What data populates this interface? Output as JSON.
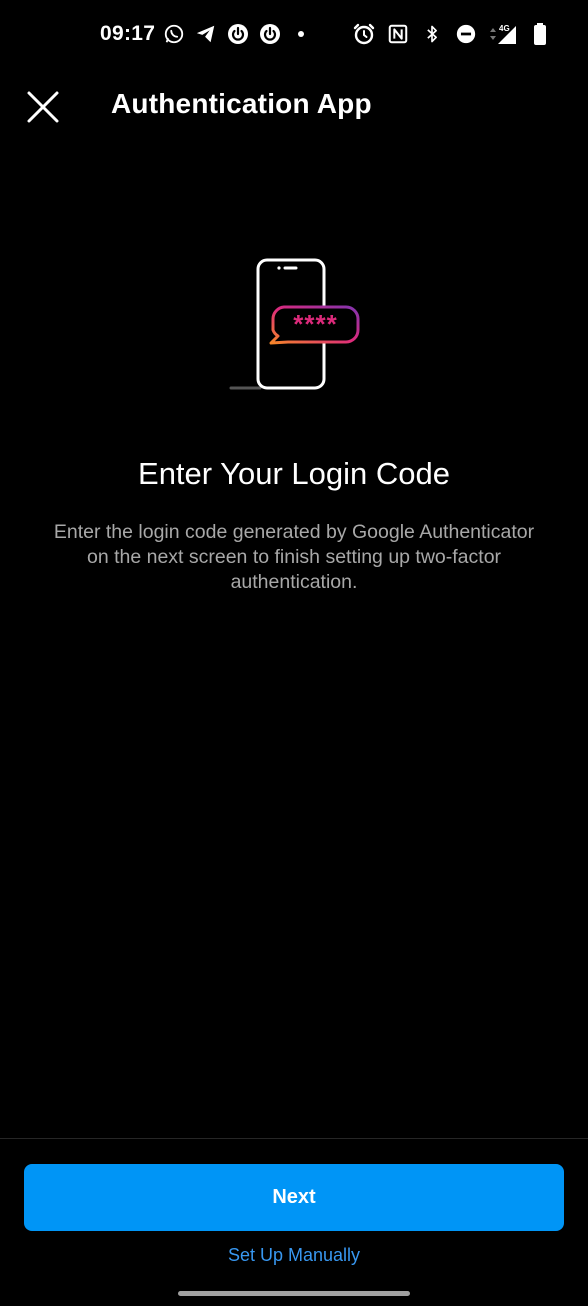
{
  "status_bar": {
    "time": "09:17",
    "left_icons": [
      "whatsapp-icon",
      "telegram-icon",
      "power-icon",
      "power-icon",
      "dot-icon"
    ],
    "right_icons": [
      "alarm-icon",
      "nfc-icon",
      "bluetooth-icon",
      "do-not-disturb-icon",
      "network-4g-icon",
      "battery-icon"
    ],
    "network_label": "4G"
  },
  "header": {
    "close_icon": "close-icon",
    "title": "Authentication App"
  },
  "illustration": {
    "icon": "phone-with-code-icon",
    "code_text": "****",
    "gradient_colors": [
      "#f58529",
      "#dd2a7b",
      "#8134af"
    ]
  },
  "main": {
    "heading": "Enter Your Login Code",
    "description": "Enter the login code generated by Google Authenticator on the next screen to finish setting up two-factor authentication."
  },
  "footer": {
    "next_label": "Next",
    "manual_label": "Set Up Manually"
  },
  "colors": {
    "background": "#000000",
    "primary_button": "#0095f6",
    "link": "#3897f0",
    "secondary_text": "#a8a8a8"
  }
}
